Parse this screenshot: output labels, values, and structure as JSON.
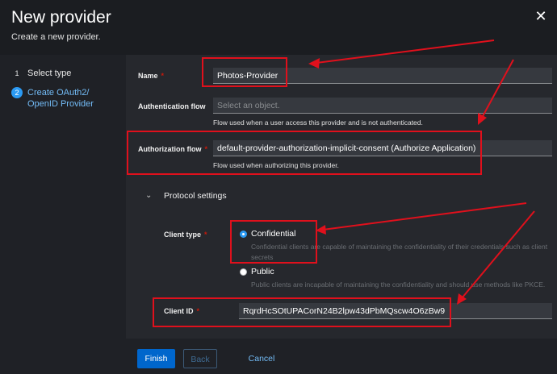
{
  "modal": {
    "title": "New provider",
    "subtitle": "Create a new provider.",
    "close_icon": "close-icon"
  },
  "wizard": {
    "steps": [
      {
        "number": "1",
        "label": "Select type",
        "active": false
      },
      {
        "number": "2",
        "label": "Create OAuth2/ OpenID Provider",
        "active": true
      }
    ]
  },
  "form": {
    "name": {
      "label": "Name",
      "required_mark": "*",
      "value": "Photos-Provider"
    },
    "authentication_flow": {
      "label": "Authentication flow",
      "placeholder": "Select an object.",
      "helper": "Flow used when a user access this provider and is not authenticated."
    },
    "authorization_flow": {
      "label": "Authorization flow",
      "required_mark": "*",
      "value": "default-provider-authorization-implicit-consent (Authorize Application)",
      "helper": "Flow used when authorizing this provider."
    },
    "protocol_settings": {
      "title": "Protocol settings",
      "toggle_icon": "chevron-down-icon",
      "client_type": {
        "label": "Client type",
        "required_mark": "*",
        "options": [
          {
            "label": "Confidential",
            "selected": true,
            "description": "Confidential clients are capable of maintaining the confidentiality of their credentials such as client secrets"
          },
          {
            "label": "Public",
            "selected": false,
            "description": "Public clients are incapable of maintaining the confidentiality and should use methods like PKCE."
          }
        ]
      },
      "client_id": {
        "label": "Client ID",
        "required_mark": "*",
        "value": "RqrdHcSOtUPACorN24B2lpw43dPbMQscw4O6zBw9"
      }
    }
  },
  "footer": {
    "finish_label": "Finish",
    "back_label": "Back",
    "cancel_label": "Cancel"
  },
  "annotation_color": "#e0101c",
  "accent_color": "#0066cc"
}
